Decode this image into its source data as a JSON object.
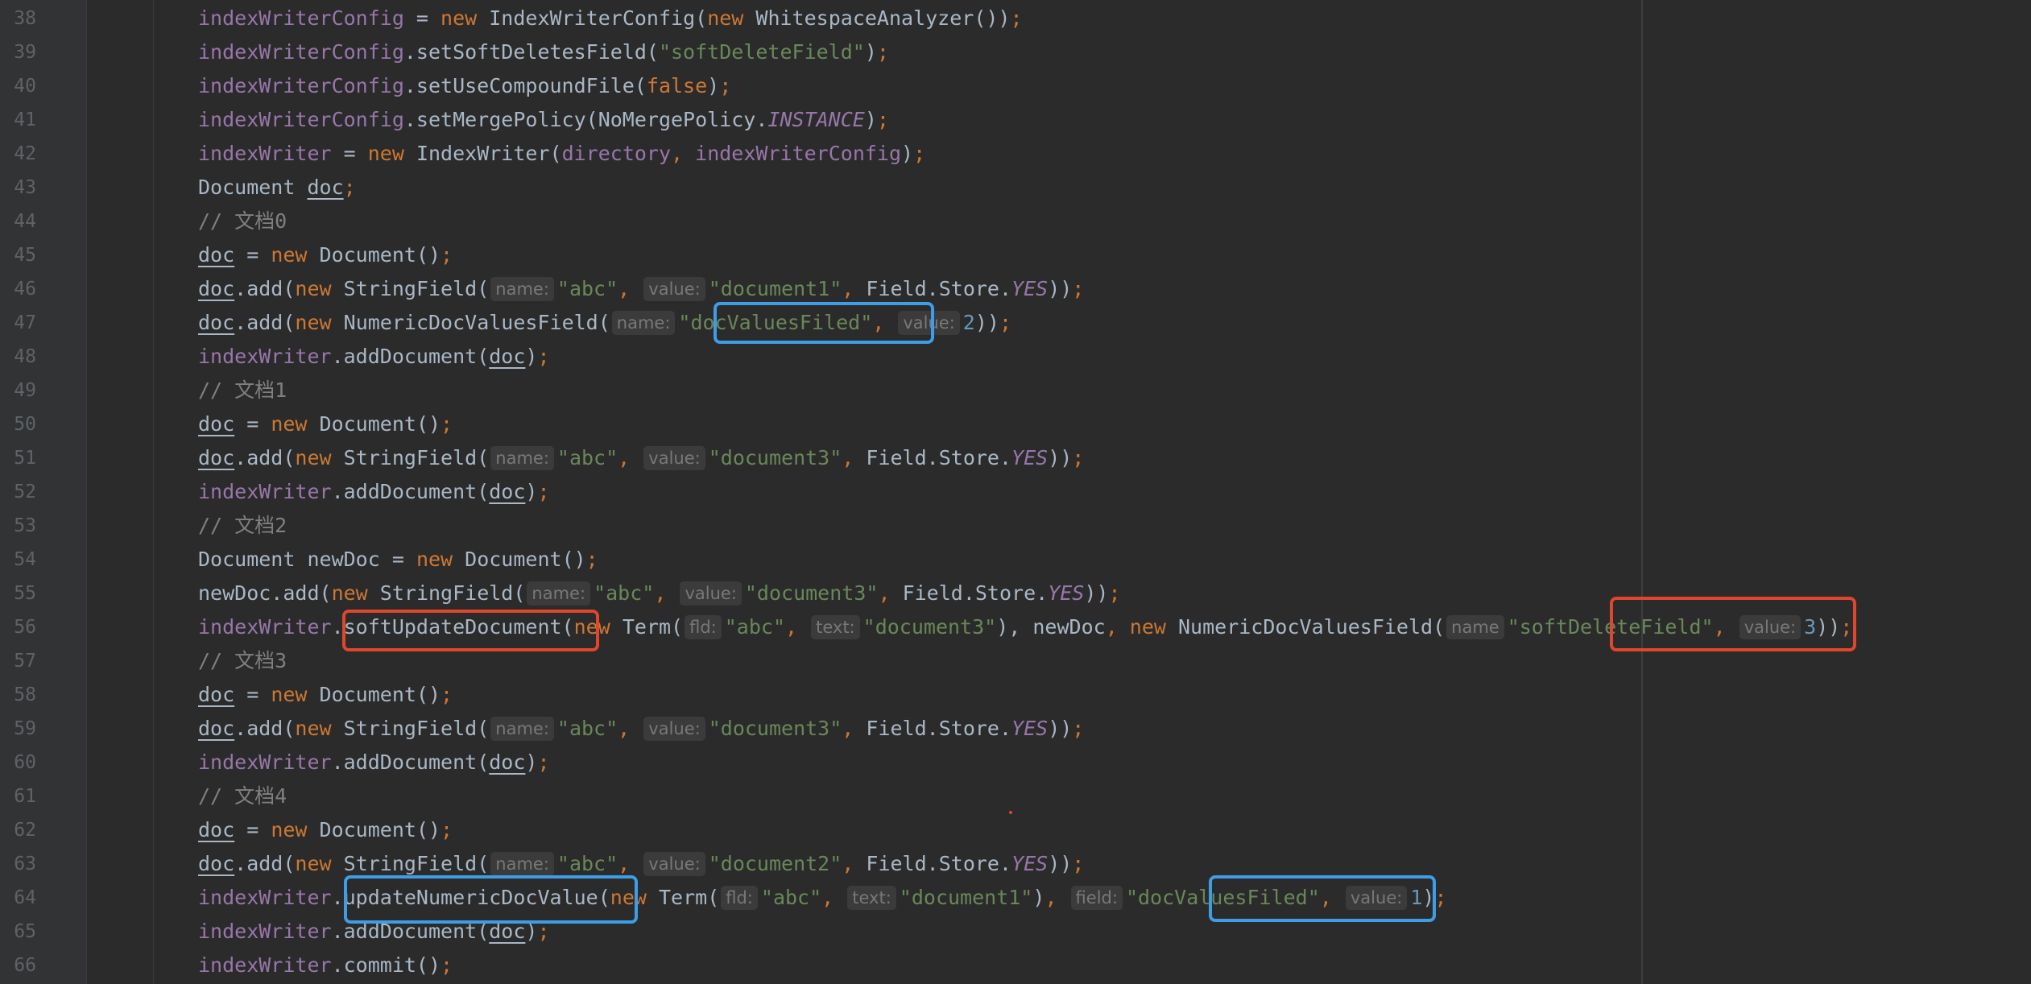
{
  "editor": {
    "lines": [
      {
        "n": "38",
        "code": [
          [
            "fld",
            "indexWriterConfig"
          ],
          [
            "pl",
            " = "
          ],
          [
            "kw",
            "new "
          ],
          [
            "pl",
            "IndexWriterConfig("
          ],
          [
            "kw",
            "new "
          ],
          [
            "pl",
            "WhitespaceAnalyzer())"
          ],
          [
            "kw",
            ";"
          ]
        ]
      },
      {
        "n": "39",
        "code": [
          [
            "fld",
            "indexWriterConfig"
          ],
          [
            "pl",
            ".setSoftDeletesField("
          ],
          [
            "str",
            "\"softDeleteField\""
          ],
          [
            "pl",
            ")"
          ],
          [
            "kw",
            ";"
          ]
        ]
      },
      {
        "n": "40",
        "code": [
          [
            "fld",
            "indexWriterConfig"
          ],
          [
            "pl",
            ".setUseCompoundFile("
          ],
          [
            "kw",
            "false"
          ],
          [
            "pl",
            ")"
          ],
          [
            "kw",
            ";"
          ]
        ]
      },
      {
        "n": "41",
        "code": [
          [
            "fld",
            "indexWriterConfig"
          ],
          [
            "pl",
            ".setMergePolicy(NoMergePolicy."
          ],
          [
            "fldi",
            "INSTANCE"
          ],
          [
            "pl",
            ")"
          ],
          [
            "kw",
            ";"
          ]
        ]
      },
      {
        "n": "42",
        "code": [
          [
            "fld",
            "indexWriter"
          ],
          [
            "pl",
            " = "
          ],
          [
            "kw",
            "new "
          ],
          [
            "pl",
            "IndexWriter("
          ],
          [
            "fld",
            "directory"
          ],
          [
            "kw",
            ", "
          ],
          [
            "fld",
            "indexWriterConfig"
          ],
          [
            "pl",
            ")"
          ],
          [
            "kw",
            ";"
          ]
        ]
      },
      {
        "n": "43",
        "code": [
          [
            "pl",
            "Document "
          ],
          [
            "ul",
            "doc"
          ],
          [
            "kw",
            ";"
          ]
        ]
      },
      {
        "n": "44",
        "code": [
          [
            "cmt",
            "// 文档0"
          ]
        ]
      },
      {
        "n": "45",
        "code": [
          [
            "ul",
            "doc"
          ],
          [
            "pl",
            " = "
          ],
          [
            "kw",
            "new "
          ],
          [
            "pl",
            "Document()"
          ],
          [
            "kw",
            ";"
          ]
        ]
      },
      {
        "n": "46",
        "code": [
          [
            "ul",
            "doc"
          ],
          [
            "pl",
            ".add("
          ],
          [
            "kw",
            "new "
          ],
          [
            "pl",
            "StringField("
          ],
          [
            "hint",
            "name:"
          ],
          [
            "str",
            "\"abc\""
          ],
          [
            "kw",
            ", "
          ],
          [
            "hint",
            "value:"
          ],
          [
            "str",
            "\"document1\""
          ],
          [
            "kw",
            ", "
          ],
          [
            "pl",
            "Field.Store."
          ],
          [
            "fldi",
            "YES"
          ],
          [
            "pl",
            "))"
          ],
          [
            "kw",
            ";"
          ]
        ]
      },
      {
        "n": "47",
        "code": [
          [
            "ul",
            "doc"
          ],
          [
            "pl",
            ".add("
          ],
          [
            "kw",
            "new "
          ],
          [
            "pl",
            "NumericDocValuesField("
          ],
          [
            "hint",
            "name:"
          ],
          [
            "str",
            "\"docValuesFiled\""
          ],
          [
            "kw",
            ", "
          ],
          [
            "hint",
            "value:"
          ],
          [
            "num",
            "2"
          ],
          [
            "pl",
            "))"
          ],
          [
            "kw",
            ";"
          ]
        ]
      },
      {
        "n": "48",
        "code": [
          [
            "fld",
            "indexWriter"
          ],
          [
            "pl",
            ".addDocument("
          ],
          [
            "ul",
            "doc"
          ],
          [
            "pl",
            ")"
          ],
          [
            "kw",
            ";"
          ]
        ]
      },
      {
        "n": "49",
        "code": [
          [
            "cmt",
            "// 文档1"
          ]
        ]
      },
      {
        "n": "50",
        "code": [
          [
            "ul",
            "doc"
          ],
          [
            "pl",
            " = "
          ],
          [
            "kw",
            "new "
          ],
          [
            "pl",
            "Document()"
          ],
          [
            "kw",
            ";"
          ]
        ]
      },
      {
        "n": "51",
        "code": [
          [
            "ul",
            "doc"
          ],
          [
            "pl",
            ".add("
          ],
          [
            "kw",
            "new "
          ],
          [
            "pl",
            "StringField("
          ],
          [
            "hint",
            "name:"
          ],
          [
            "str",
            "\"abc\""
          ],
          [
            "kw",
            ", "
          ],
          [
            "hint",
            "value:"
          ],
          [
            "str",
            "\"document3\""
          ],
          [
            "kw",
            ", "
          ],
          [
            "pl",
            "Field.Store."
          ],
          [
            "fldi",
            "YES"
          ],
          [
            "pl",
            "))"
          ],
          [
            "kw",
            ";"
          ]
        ]
      },
      {
        "n": "52",
        "code": [
          [
            "fld",
            "indexWriter"
          ],
          [
            "pl",
            ".addDocument("
          ],
          [
            "ul",
            "doc"
          ],
          [
            "pl",
            ")"
          ],
          [
            "kw",
            ";"
          ]
        ]
      },
      {
        "n": "53",
        "code": [
          [
            "cmt",
            "// 文档2"
          ]
        ]
      },
      {
        "n": "54",
        "code": [
          [
            "pl",
            "Document newDoc = "
          ],
          [
            "kw",
            "new "
          ],
          [
            "pl",
            "Document()"
          ],
          [
            "kw",
            ";"
          ]
        ]
      },
      {
        "n": "55",
        "code": [
          [
            "pl",
            "newDoc.add("
          ],
          [
            "kw",
            "new "
          ],
          [
            "pl",
            "StringField("
          ],
          [
            "hint",
            "name:"
          ],
          [
            "str",
            "\"abc\""
          ],
          [
            "kw",
            ", "
          ],
          [
            "hint",
            "value:"
          ],
          [
            "str",
            "\"document3\""
          ],
          [
            "kw",
            ", "
          ],
          [
            "pl",
            "Field.Store."
          ],
          [
            "fldi",
            "YES"
          ],
          [
            "pl",
            "))"
          ],
          [
            "kw",
            ";"
          ]
        ]
      },
      {
        "n": "56",
        "code": [
          [
            "fld",
            "indexWriter"
          ],
          [
            "pl",
            ".softUpdateDocument("
          ],
          [
            "kw",
            "new "
          ],
          [
            "pl",
            "Term("
          ],
          [
            "hint",
            "fld:"
          ],
          [
            "str",
            "\"abc\""
          ],
          [
            "kw",
            ", "
          ],
          [
            "hint",
            "text:"
          ],
          [
            "str",
            "\"document3\""
          ],
          [
            "pl",
            "), newDoc"
          ],
          [
            "kw",
            ", new "
          ],
          [
            "pl",
            "NumericDocValuesField("
          ],
          [
            "hint",
            "name"
          ],
          [
            "str",
            "\"softDeleteField\""
          ],
          [
            "kw",
            ", "
          ],
          [
            "hint",
            "value:"
          ],
          [
            "num",
            "3"
          ],
          [
            "pl",
            "))"
          ],
          [
            "kw",
            ";"
          ]
        ]
      },
      {
        "n": "57",
        "code": [
          [
            "cmt",
            "// 文档3"
          ]
        ]
      },
      {
        "n": "58",
        "code": [
          [
            "ul",
            "doc"
          ],
          [
            "pl",
            " = "
          ],
          [
            "kw",
            "new "
          ],
          [
            "pl",
            "Document()"
          ],
          [
            "kw",
            ";"
          ]
        ]
      },
      {
        "n": "59",
        "code": [
          [
            "ul",
            "doc"
          ],
          [
            "pl",
            ".add("
          ],
          [
            "kw",
            "new "
          ],
          [
            "pl",
            "StringField("
          ],
          [
            "hint",
            "name:"
          ],
          [
            "str",
            "\"abc\""
          ],
          [
            "kw",
            ", "
          ],
          [
            "hint",
            "value:"
          ],
          [
            "str",
            "\"document3\""
          ],
          [
            "kw",
            ", "
          ],
          [
            "pl",
            "Field.Store."
          ],
          [
            "fldi",
            "YES"
          ],
          [
            "pl",
            "))"
          ],
          [
            "kw",
            ";"
          ]
        ]
      },
      {
        "n": "60",
        "code": [
          [
            "fld",
            "indexWriter"
          ],
          [
            "pl",
            ".addDocument("
          ],
          [
            "ul",
            "doc"
          ],
          [
            "pl",
            ")"
          ],
          [
            "kw",
            ";"
          ]
        ]
      },
      {
        "n": "61",
        "code": [
          [
            "cmt",
            "// 文档4"
          ]
        ]
      },
      {
        "n": "62",
        "code": [
          [
            "ul",
            "doc"
          ],
          [
            "pl",
            " = "
          ],
          [
            "kw",
            "new "
          ],
          [
            "pl",
            "Document()"
          ],
          [
            "kw",
            ";"
          ]
        ]
      },
      {
        "n": "63",
        "code": [
          [
            "ul",
            "doc"
          ],
          [
            "pl",
            ".add("
          ],
          [
            "kw",
            "new "
          ],
          [
            "pl",
            "StringField("
          ],
          [
            "hint",
            "name:"
          ],
          [
            "str",
            "\"abc\""
          ],
          [
            "kw",
            ", "
          ],
          [
            "hint",
            "value:"
          ],
          [
            "str",
            "\"document2\""
          ],
          [
            "kw",
            ", "
          ],
          [
            "pl",
            "Field.Store."
          ],
          [
            "fldi",
            "YES"
          ],
          [
            "pl",
            "))"
          ],
          [
            "kw",
            ";"
          ]
        ]
      },
      {
        "n": "64",
        "code": [
          [
            "fld",
            "indexWriter"
          ],
          [
            "pl",
            ".updateNumericDocValue("
          ],
          [
            "kw",
            "new "
          ],
          [
            "pl",
            "Term("
          ],
          [
            "hint",
            "fld:"
          ],
          [
            "str",
            "\"abc\""
          ],
          [
            "kw",
            ", "
          ],
          [
            "hint",
            "text:"
          ],
          [
            "str",
            "\"document1\""
          ],
          [
            "pl",
            ")"
          ],
          [
            "kw",
            ", "
          ],
          [
            "hint",
            "field:"
          ],
          [
            "str",
            "\"docValuesFiled\""
          ],
          [
            "kw",
            ", "
          ],
          [
            "hint",
            "value:"
          ],
          [
            "num",
            "1"
          ],
          [
            "pl",
            ")"
          ],
          [
            "kw",
            ";"
          ]
        ]
      },
      {
        "n": "65",
        "code": [
          [
            "fld",
            "indexWriter"
          ],
          [
            "pl",
            ".addDocument("
          ],
          [
            "ul",
            "doc"
          ],
          [
            "pl",
            ")"
          ],
          [
            "kw",
            ";"
          ]
        ]
      },
      {
        "n": "66",
        "code": [
          [
            "fld",
            "indexWriter"
          ],
          [
            "pl",
            ".commit()"
          ],
          [
            "kw",
            ";"
          ]
        ]
      }
    ]
  },
  "annotations": {
    "red_color": "#e0462b",
    "blue_color": "#3d9de6"
  }
}
